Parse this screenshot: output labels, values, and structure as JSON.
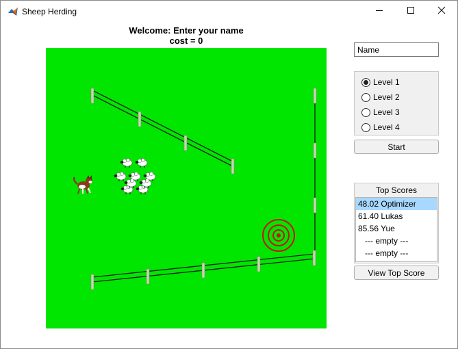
{
  "window": {
    "title": "Sheep Herding",
    "icon": "matlab-icon",
    "controls": [
      "minimize-icon",
      "maximize-icon",
      "close-icon"
    ]
  },
  "header": {
    "welcome": "Welcome: Enter your name",
    "cost": "cost = 0"
  },
  "name_input": {
    "value": "Name",
    "placeholder": ""
  },
  "levels": {
    "options": [
      "Level 1",
      "Level 2",
      "Level 3",
      "Level 4"
    ],
    "selected_index": 0
  },
  "start_label": "Start",
  "top_scores": {
    "title": "Top Scores",
    "entries": [
      "48.02 Optimizer",
      "61.40 Lukas",
      "85.56 Yue",
      "   --- empty ---",
      "   --- empty ---"
    ],
    "selected_index": 0
  },
  "view_top_score_label": "View Top Score",
  "colors": {
    "field": "#00e600",
    "fence": "#1a1a1a",
    "post": "#c8d6b0",
    "target": "#cc1111",
    "selection": "#a8d8ff"
  },
  "scene": {
    "sheep_count": 9,
    "objects": [
      "dog-icon",
      "sheep-icon",
      "fence",
      "target-icon"
    ]
  }
}
